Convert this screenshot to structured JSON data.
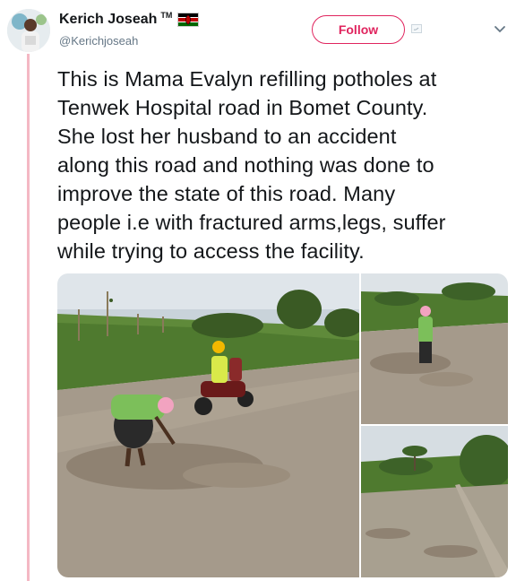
{
  "user": {
    "display_name": "Kerich Joseah",
    "tm": "TM",
    "handle": "@Kerichjoseah",
    "avatar_icon": "avatar-photo"
  },
  "actions": {
    "follow_label": "Follow"
  },
  "icons": {
    "flag": "kenya-flag-icon",
    "bird": "twitter-bird-icon",
    "menu": "chevron-down-icon"
  },
  "tweet": {
    "text": "This is Mama Evalyn refilling potholes at\nTenwek Hospital road in Bomet County.\nShe lost her husband to an accident\nalong this road and nothing was done to\nimprove the state of this road. Many\npeople i.e with fractured arms,legs, suffer\nwhile trying to access the facility."
  },
  "colors": {
    "accent": "#e0245e",
    "thread_line": "#f4b8c4",
    "handle": "#657786",
    "text": "#14171a"
  }
}
